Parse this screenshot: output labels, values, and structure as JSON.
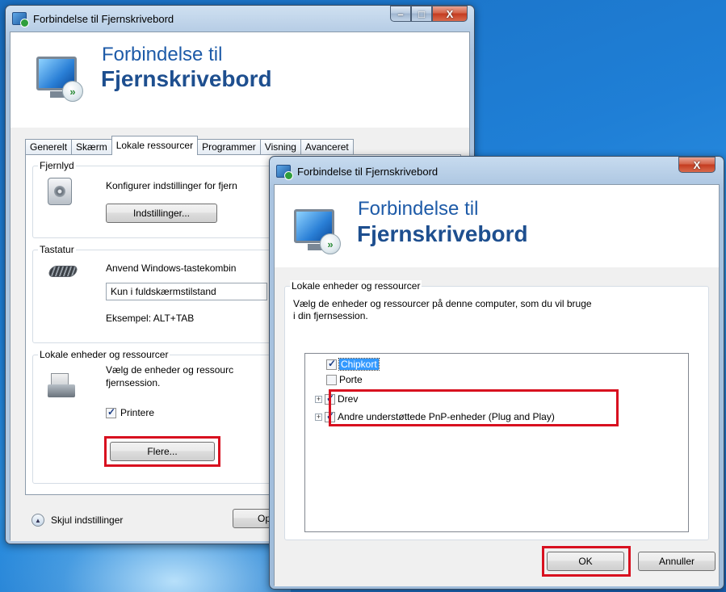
{
  "back_window": {
    "title": "Forbindelse til Fjernskrivebord",
    "banner_line1": "Forbindelse til",
    "banner_line2": "Fjernskrivebord",
    "caption_min": "–",
    "caption_max": "□",
    "caption_close": "X",
    "tabs": [
      {
        "label": "Generelt",
        "active": false
      },
      {
        "label": "Skærm",
        "active": false
      },
      {
        "label": "Lokale ressourcer",
        "active": true
      },
      {
        "label": "Programmer",
        "active": false
      },
      {
        "label": "Visning",
        "active": false
      },
      {
        "label": "Avanceret",
        "active": false
      }
    ],
    "audio_group": {
      "label": "Fjernlyd",
      "description": "Konfigurer indstillinger for fjern",
      "settings_button": "Indstillinger..."
    },
    "keyboard_group": {
      "label": "Tastatur",
      "description": "Anvend Windows-tastekombin",
      "select_value": "Kun i fuldskærmstilstand",
      "example": "Eksempel: ALT+TAB"
    },
    "local_group": {
      "label": "Lokale enheder og ressourcer",
      "description_line1": "Vælg de enheder og ressourc",
      "description_line2": "fjernsession.",
      "printers_label": "Printere",
      "printers_checked": true,
      "more_button": "Flere..."
    },
    "hide_settings_label": "Skjul indstillinger",
    "open_button_partial": "Op"
  },
  "front_window": {
    "title": "Forbindelse til Fjernskrivebord",
    "caption_close": "X",
    "banner_line1": "Forbindelse til",
    "banner_line2": "Fjernskrivebord",
    "group_label": "Lokale enheder og ressourcer",
    "description_line1": "Vælg de enheder og ressourcer på denne computer, som du vil bruge",
    "description_line2": "i din fjernsession.",
    "tree_items": [
      {
        "label": "Chipkort",
        "checked": true,
        "expandable": false,
        "selected": true
      },
      {
        "label": "Porte",
        "checked": false,
        "expandable": false,
        "selected": false
      },
      {
        "label": "Drev",
        "checked": true,
        "expandable": true,
        "selected": false
      },
      {
        "label": "Andre understøttede PnP-enheder (Plug and Play)",
        "checked": true,
        "expandable": true,
        "selected": false
      }
    ],
    "ok_button": "OK",
    "cancel_button": "Annuller"
  },
  "highlight_color": "#d8101f"
}
